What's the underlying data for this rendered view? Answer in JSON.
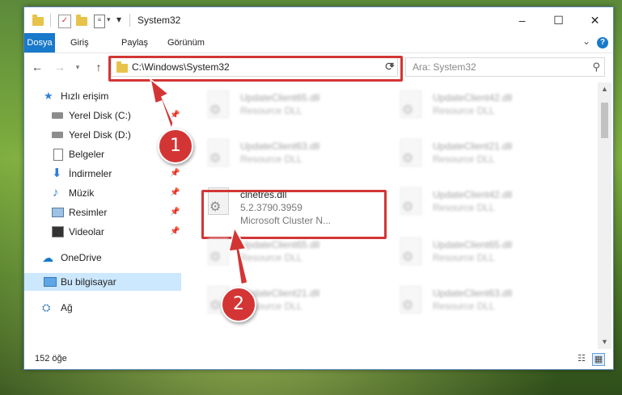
{
  "window": {
    "title": "System32",
    "controls": {
      "minimize": "–",
      "maximize": "☐",
      "close": "✕"
    }
  },
  "ribbon": {
    "tabs": [
      "Dosya",
      "Giriş",
      "Paylaş",
      "Görünüm"
    ],
    "help": "?"
  },
  "navigation": {
    "address": "C:\\Windows\\System32",
    "search_placeholder": "Ara: System32"
  },
  "sidebar": {
    "items": [
      {
        "label": "Hızlı erişim",
        "icon": "star-icon"
      },
      {
        "label": "Yerel Disk (C:)",
        "icon": "drive-icon",
        "pinned": true
      },
      {
        "label": "Yerel Disk (D:)",
        "icon": "drive-icon"
      },
      {
        "label": "Belgeler",
        "icon": "documents-icon"
      },
      {
        "label": "İndirmeler",
        "icon": "download-icon",
        "pinned": true
      },
      {
        "label": "Müzik",
        "icon": "music-icon",
        "pinned": true
      },
      {
        "label": "Resimler",
        "icon": "pictures-icon",
        "pinned": true
      },
      {
        "label": "Videolar",
        "icon": "videos-icon",
        "pinned": true
      },
      {
        "label": "OneDrive",
        "icon": "cloud-icon"
      },
      {
        "label": "Bu bilgisayar",
        "icon": "computer-icon",
        "selected": true
      },
      {
        "label": "Ağ",
        "icon": "network-icon"
      }
    ]
  },
  "files": {
    "highlighted": {
      "name": "clnetres.dll",
      "version": "5.2.3790.3959",
      "description": "Microsoft Cluster N..."
    },
    "blurred": [
      {
        "name": "UpdateClient65.dll",
        "desc": "Resource DLL"
      },
      {
        "name": "UpdateClient42.dll",
        "desc": "Resource DLL"
      },
      {
        "name": "UpdateClient63.dll",
        "desc": "Resource DLL"
      },
      {
        "name": "UpdateClient21.dll",
        "desc": "Resource DLL"
      },
      {
        "name": "UpdateClient42.dll",
        "desc": "Resource DLL"
      },
      {
        "name": "UpdateClient65.dll",
        "desc": "Resource DLL"
      },
      {
        "name": "UpdateClient65.dll",
        "desc": "Resource DLL"
      },
      {
        "name": "UpdateClient21.dll",
        "desc": "Resource DLL"
      },
      {
        "name": "UpdateClient63.dll",
        "desc": "Resource DLL"
      }
    ]
  },
  "status": {
    "count": "152 öğe"
  },
  "callouts": [
    "1",
    "2"
  ],
  "colors": {
    "accent": "#1979ca",
    "highlight": "#d33535",
    "selected": "#cce8ff"
  }
}
